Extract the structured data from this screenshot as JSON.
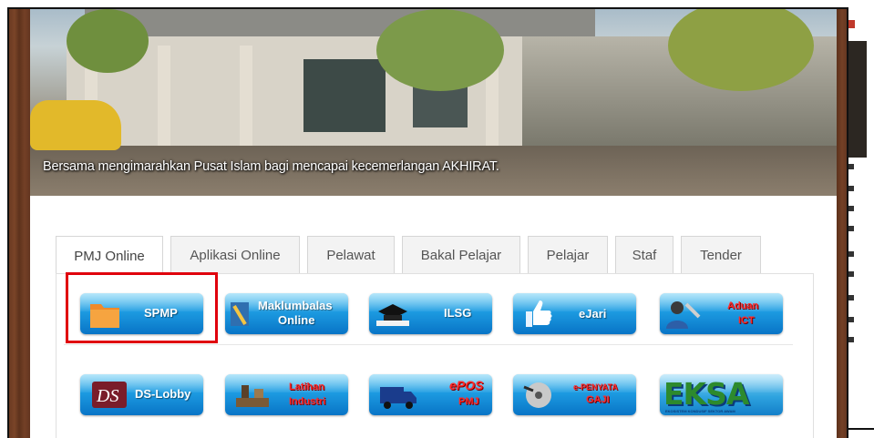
{
  "hero": {
    "caption": "Bersama mengimarahkan Pusat Islam bagi mencapai kecemerlangan AKHIRAT."
  },
  "tabs": [
    {
      "label": "PMJ Online",
      "active": true
    },
    {
      "label": "Aplikasi Online",
      "active": false
    },
    {
      "label": "Pelawat",
      "active": false
    },
    {
      "label": "Bakal Pelajar",
      "active": false
    },
    {
      "label": "Pelajar",
      "active": false
    },
    {
      "label": "Staf",
      "active": false
    },
    {
      "label": "Tender",
      "active": false
    }
  ],
  "tiles": {
    "spmp": "SPMP",
    "maklumbalas_1": "Maklumbalas",
    "maklumbalas_2": "Online",
    "ilsg": "ILSG",
    "ejari": "eJari",
    "aduan_1": "Aduan",
    "aduan_2": "ICT",
    "dslobby": "DS-Lobby",
    "latihan_1": "Latihan",
    "latihan_2": "Industri",
    "epos_1": "ePOS",
    "epos_2": "PMJ",
    "epenyata_1": "e-PENYATA",
    "epenyata_2": "GAJI",
    "eksa": "EKSA",
    "eksa_sub": "EKOSISTEM KONDUSIF SEKTOR AWAM"
  },
  "colors": {
    "tile_top": "#5ec8f5",
    "tile_bottom": "#0874c6",
    "highlight": "#e0000c",
    "frame_wood": "#6b3b22"
  }
}
